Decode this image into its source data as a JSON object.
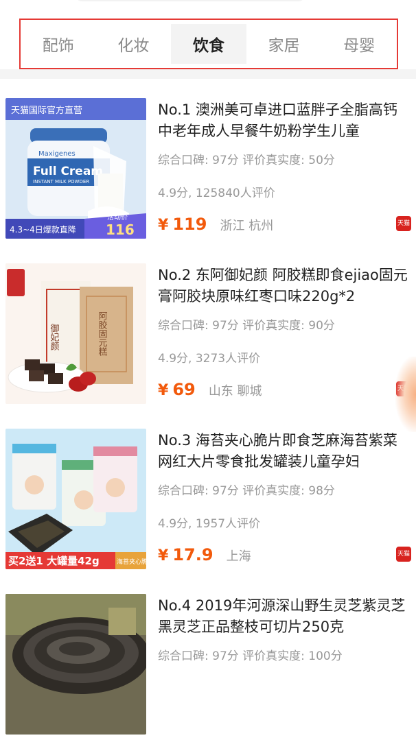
{
  "tabs": [
    {
      "label": "配饰",
      "active": false
    },
    {
      "label": "化妆",
      "active": false
    },
    {
      "label": "饮食",
      "active": true
    },
    {
      "label": "家居",
      "active": false
    },
    {
      "label": "母婴",
      "active": false
    }
  ],
  "currency_symbol": "¥",
  "products": [
    {
      "title": "No.1 澳洲美可卓进口蓝胖子全脂高钙中老年成人早餐牛奶粉学生儿童",
      "reputation": "综合口碑: 97分 评价真实度: 50分",
      "rating": "4.9分, 125840人评价",
      "price": "119",
      "location": "浙江 杭州",
      "badge": "天猫",
      "image": {
        "store_banner": "天猫国际官方直营",
        "brand": "Maxigenes",
        "can_title": "Full Cream",
        "can_subtitle": "INSTANT MILK POWDER",
        "promo_text": "4.3~4日爆款直降",
        "promo_price_label": "活动价",
        "promo_price": "116"
      }
    },
    {
      "title": "No.2 东阿御妃颜 阿胶糕即食ejiao固元膏阿胶块原味红枣口味220g*2",
      "reputation": "综合口碑: 97分 评价真实度: 90分",
      "rating": "4.9分, 3273人评价",
      "price": "69",
      "location": "山东 聊城",
      "badge": "天猫",
      "image": {
        "bag_text": "御妃颜",
        "bag_text2": "阿胶固元糕"
      }
    },
    {
      "title": "No.3 海苔夹心脆片即食芝麻海苔紫菜网红大片零食批发罐装儿童孕妇",
      "reputation": "综合口碑: 97分 评价真实度: 98分",
      "rating": "4.9分, 1957人评价",
      "price": "17.9",
      "location": "上海",
      "badge": "天猫",
      "image": {
        "promo_text": "买2送1 大罐量42g",
        "side_text": "海苔夹心脆"
      }
    },
    {
      "title": "No.4 2019年河源深山野生灵芝紫灵芝黑灵芝正品整枝可切片250克",
      "reputation": "综合口碑: 97分 评价真实度: 100分",
      "rating": "",
      "price": "",
      "location": "",
      "badge": "",
      "image": {}
    }
  ]
}
